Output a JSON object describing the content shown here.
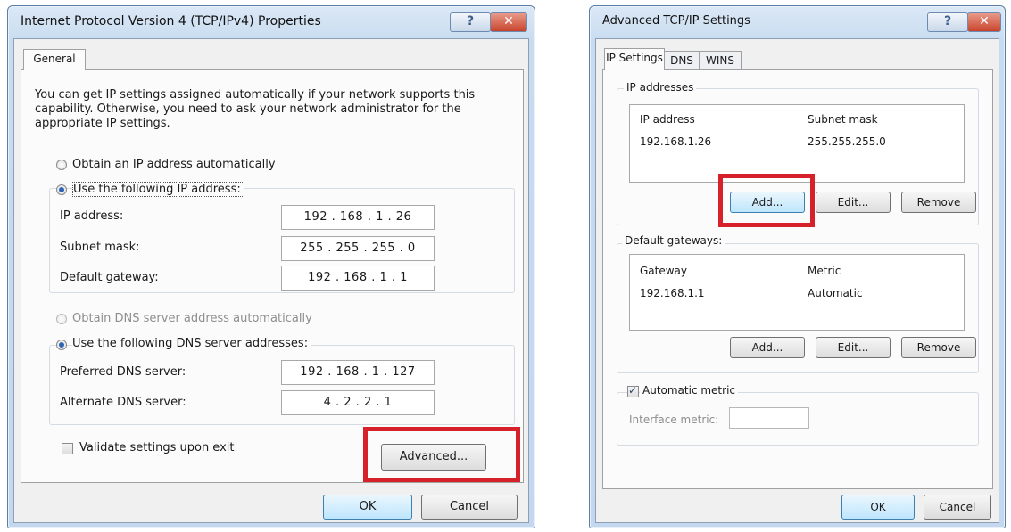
{
  "left_window": {
    "title": "Internet Protocol Version 4 (TCP/IPv4) Properties",
    "help_glyph": "?",
    "close_glyph": "✕",
    "tab_general": "General",
    "description": "You can get IP settings assigned automatically if your network supports this capability. Otherwise, you need to ask your network administrator for the appropriate IP settings.",
    "radio_auto_ip": "Obtain an IP address automatically",
    "radio_manual_ip": "Use the following IP address:",
    "ip_label": "IP address:",
    "ip_value": "192 . 168 .  1  .  26",
    "subnet_label": "Subnet mask:",
    "subnet_value": "255 . 255 . 255 .  0",
    "gateway_label": "Default gateway:",
    "gateway_value": "192 . 168 .  1  .  1",
    "radio_auto_dns": "Obtain DNS server address automatically",
    "radio_manual_dns": "Use the following DNS server addresses:",
    "pref_dns_label": "Preferred DNS server:",
    "pref_dns_value": "192 . 168 .  1  . 127",
    "alt_dns_label": "Alternate DNS server:",
    "alt_dns_value": "4  .  2  .  2  .  1",
    "validate_label": "Validate settings upon exit",
    "advanced_button": "Advanced...",
    "ok_button": "OK",
    "cancel_button": "Cancel",
    "radio_states": {
      "auto_ip": false,
      "manual_ip": true,
      "auto_dns": false,
      "manual_dns": true
    },
    "validate_checked": false
  },
  "right_window": {
    "title": "Advanced TCP/IP Settings",
    "help_glyph": "?",
    "close_glyph": "✕",
    "tabs": [
      "IP Settings",
      "DNS",
      "WINS"
    ],
    "ip_group_label": "IP addresses",
    "ip_col_address": "IP address",
    "ip_col_subnet": "Subnet mask",
    "ip_row": {
      "address": "192.168.1.26",
      "subnet": "255.255.255.0"
    },
    "ip_add_button": "Add...",
    "ip_edit_button": "Edit...",
    "ip_remove_button": "Remove",
    "gw_group_label": "Default gateways:",
    "gw_col_gateway": "Gateway",
    "gw_col_metric": "Metric",
    "gw_row": {
      "gateway": "192.168.1.1",
      "metric": "Automatic"
    },
    "gw_add_button": "Add...",
    "gw_edit_button": "Edit...",
    "gw_remove_button": "Remove",
    "auto_metric_label": "Automatic metric",
    "auto_metric_checked": true,
    "interface_metric_label": "Interface metric:",
    "interface_metric_value": "",
    "ok_button": "OK",
    "cancel_button": "Cancel"
  },
  "colors": {
    "highlight": "#d6202a",
    "title_bar": "#c8dcf0",
    "default_button": "#bee6fd"
  }
}
